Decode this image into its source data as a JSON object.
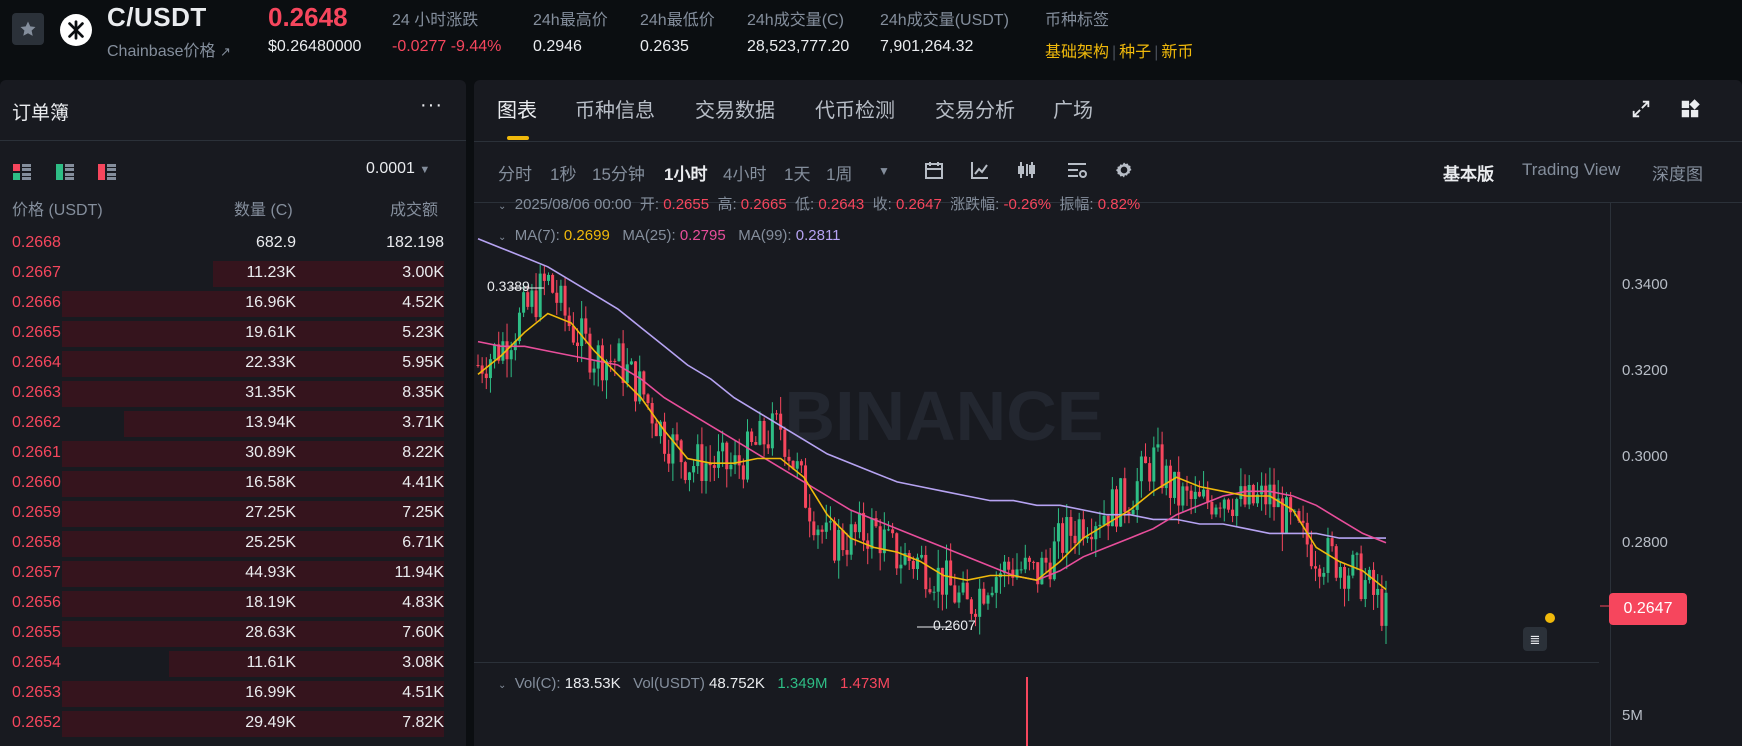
{
  "header": {
    "pair": "C/USDT",
    "sub_label": "Chainbase价格",
    "sub_arrow": "↗",
    "last_price": "0.2648",
    "last_price_usd": "$0.26480000",
    "stats": [
      {
        "label": "24 小时涨跌",
        "value": "-0.0277 -9.44%",
        "negative": true
      },
      {
        "label": "24h最高价",
        "value": "0.2946"
      },
      {
        "label": "24h最低价",
        "value": "0.2635"
      },
      {
        "label": "24h成交量(C)",
        "value": "28,523,777.20"
      },
      {
        "label": "24h成交量(USDT)",
        "value": "7,901,264.32"
      },
      {
        "label": "币种标签",
        "value": ""
      }
    ],
    "tags": [
      "基础架构",
      "种子",
      "新币"
    ]
  },
  "orderbook": {
    "title": "订单簿",
    "more": "···",
    "precision": "0.0001",
    "col_price": "价格 (USDT)",
    "col_qty": "数量 (C)",
    "col_total": "成交额",
    "rows": [
      {
        "price": "0.2668",
        "qty": "682.9",
        "total": "182.198",
        "depth": 0.0
      },
      {
        "price": "0.2667",
        "qty": "11.23K",
        "total": "3.00K",
        "depth": 0.52
      },
      {
        "price": "0.2666",
        "qty": "16.96K",
        "total": "4.52K",
        "depth": 0.86
      },
      {
        "price": "0.2665",
        "qty": "19.61K",
        "total": "5.23K",
        "depth": 0.86
      },
      {
        "price": "0.2664",
        "qty": "22.33K",
        "total": "5.95K",
        "depth": 0.86
      },
      {
        "price": "0.2663",
        "qty": "31.35K",
        "total": "8.35K",
        "depth": 0.86
      },
      {
        "price": "0.2662",
        "qty": "13.94K",
        "total": "3.71K",
        "depth": 0.72
      },
      {
        "price": "0.2661",
        "qty": "30.89K",
        "total": "8.22K",
        "depth": 0.86
      },
      {
        "price": "0.2660",
        "qty": "16.58K",
        "total": "4.41K",
        "depth": 0.86
      },
      {
        "price": "0.2659",
        "qty": "27.25K",
        "total": "7.25K",
        "depth": 0.86
      },
      {
        "price": "0.2658",
        "qty": "25.25K",
        "total": "6.71K",
        "depth": 0.86
      },
      {
        "price": "0.2657",
        "qty": "44.93K",
        "total": "11.94K",
        "depth": 0.86
      },
      {
        "price": "0.2656",
        "qty": "18.19K",
        "total": "4.83K",
        "depth": 0.86
      },
      {
        "price": "0.2655",
        "qty": "28.63K",
        "total": "7.60K",
        "depth": 0.86
      },
      {
        "price": "0.2654",
        "qty": "11.61K",
        "total": "3.08K",
        "depth": 0.62
      },
      {
        "price": "0.2653",
        "qty": "16.99K",
        "total": "4.51K",
        "depth": 0.86
      },
      {
        "price": "0.2652",
        "qty": "29.49K",
        "total": "7.82K",
        "depth": 0.86
      }
    ]
  },
  "chart_panel": {
    "tabs": [
      "图表",
      "币种信息",
      "交易数据",
      "代币检测",
      "交易分析",
      "广场"
    ],
    "intervals": [
      "分时",
      "1秒",
      "15分钟",
      "1小时",
      "4小时",
      "1天",
      "1周"
    ],
    "active_interval": "1小时",
    "views": [
      "基本版",
      "Trading View",
      "深度图"
    ],
    "active_view": "基本版",
    "ohlc": {
      "date": "2025/08/06 00:00",
      "open_label": "开:",
      "open": "0.2655",
      "high_label": "高:",
      "high": "0.2665",
      "low_label": "低:",
      "low": "0.2643",
      "close_label": "收:",
      "close": "0.2647",
      "change_label": "涨跌幅:",
      "change": "-0.26%",
      "amp_label": "振幅:",
      "amp": "0.82%"
    },
    "ma": {
      "ma7_label": "MA(7):",
      "ma7": "0.2699",
      "ma25_label": "MA(25):",
      "ma25": "0.2795",
      "ma99_label": "MA(99):",
      "ma99": "0.2811"
    },
    "vol": {
      "label1": "Vol(C):",
      "v1": "183.53K",
      "label2": "Vol(USDT)",
      "v2": "48.752K",
      "v3": "1.349M",
      "v4": "1.473M"
    },
    "annotations": {
      "high": "0.3389",
      "low": "0.2607"
    },
    "current_price": "0.2647",
    "watermark": "BINANCE",
    "vol_axis": "5M",
    "colors": {
      "up": "#2ebd85",
      "down": "#f6465d",
      "ma7": "#f0b90b",
      "ma25": "#e84e9b",
      "ma99": "#b6a3f2"
    }
  },
  "chart_data": {
    "type": "line",
    "title": "",
    "xlabel": "",
    "ylabel": "",
    "y_ticks": [
      "0.3400",
      "0.3200",
      "0.3000",
      "0.2800"
    ],
    "ylim": [
      0.256,
      0.349
    ],
    "series": [
      {
        "name": "MA(7)",
        "values": [
          0.316,
          0.32,
          0.325,
          0.329,
          0.327,
          0.321,
          0.316,
          0.311,
          0.304,
          0.298,
          0.297,
          0.297,
          0.298,
          0.298,
          0.294,
          0.286,
          0.281,
          0.279,
          0.278,
          0.276,
          0.273,
          0.272,
          0.273,
          0.273,
          0.272,
          0.276,
          0.281,
          0.284,
          0.287,
          0.291,
          0.294,
          0.292,
          0.291,
          0.29,
          0.29,
          0.287,
          0.279,
          0.276,
          0.274,
          0.27
        ]
      },
      {
        "name": "MA(25)",
        "values": [
          0.323,
          0.322,
          0.322,
          0.321,
          0.32,
          0.319,
          0.318,
          0.315,
          0.311,
          0.308,
          0.305,
          0.302,
          0.299,
          0.296,
          0.293,
          0.29,
          0.287,
          0.285,
          0.283,
          0.281,
          0.279,
          0.277,
          0.275,
          0.273,
          0.272,
          0.274,
          0.277,
          0.279,
          0.281,
          0.283,
          0.286,
          0.288,
          0.29,
          0.291,
          0.291,
          0.29,
          0.288,
          0.285,
          0.282,
          0.28
        ]
      },
      {
        "name": "MA(99)",
        "values": [
          0.345,
          0.343,
          0.341,
          0.339,
          0.336,
          0.333,
          0.33,
          0.326,
          0.322,
          0.318,
          0.315,
          0.311,
          0.308,
          0.305,
          0.302,
          0.299,
          0.297,
          0.295,
          0.293,
          0.292,
          0.291,
          0.29,
          0.289,
          0.289,
          0.288,
          0.288,
          0.287,
          0.286,
          0.286,
          0.285,
          0.285,
          0.284,
          0.284,
          0.283,
          0.282,
          0.282,
          0.282,
          0.281,
          0.281,
          0.281
        ]
      },
      {
        "name": "close",
        "values": [
          0.318,
          0.322,
          0.329,
          0.336,
          0.326,
          0.32,
          0.319,
          0.313,
          0.303,
          0.297,
          0.297,
          0.296,
          0.301,
          0.305,
          0.291,
          0.28,
          0.281,
          0.283,
          0.277,
          0.276,
          0.272,
          0.266,
          0.273,
          0.275,
          0.273,
          0.28,
          0.285,
          0.287,
          0.29,
          0.298,
          0.29,
          0.288,
          0.291,
          0.288,
          0.29,
          0.283,
          0.278,
          0.276,
          0.272,
          0.265
        ]
      }
    ]
  }
}
